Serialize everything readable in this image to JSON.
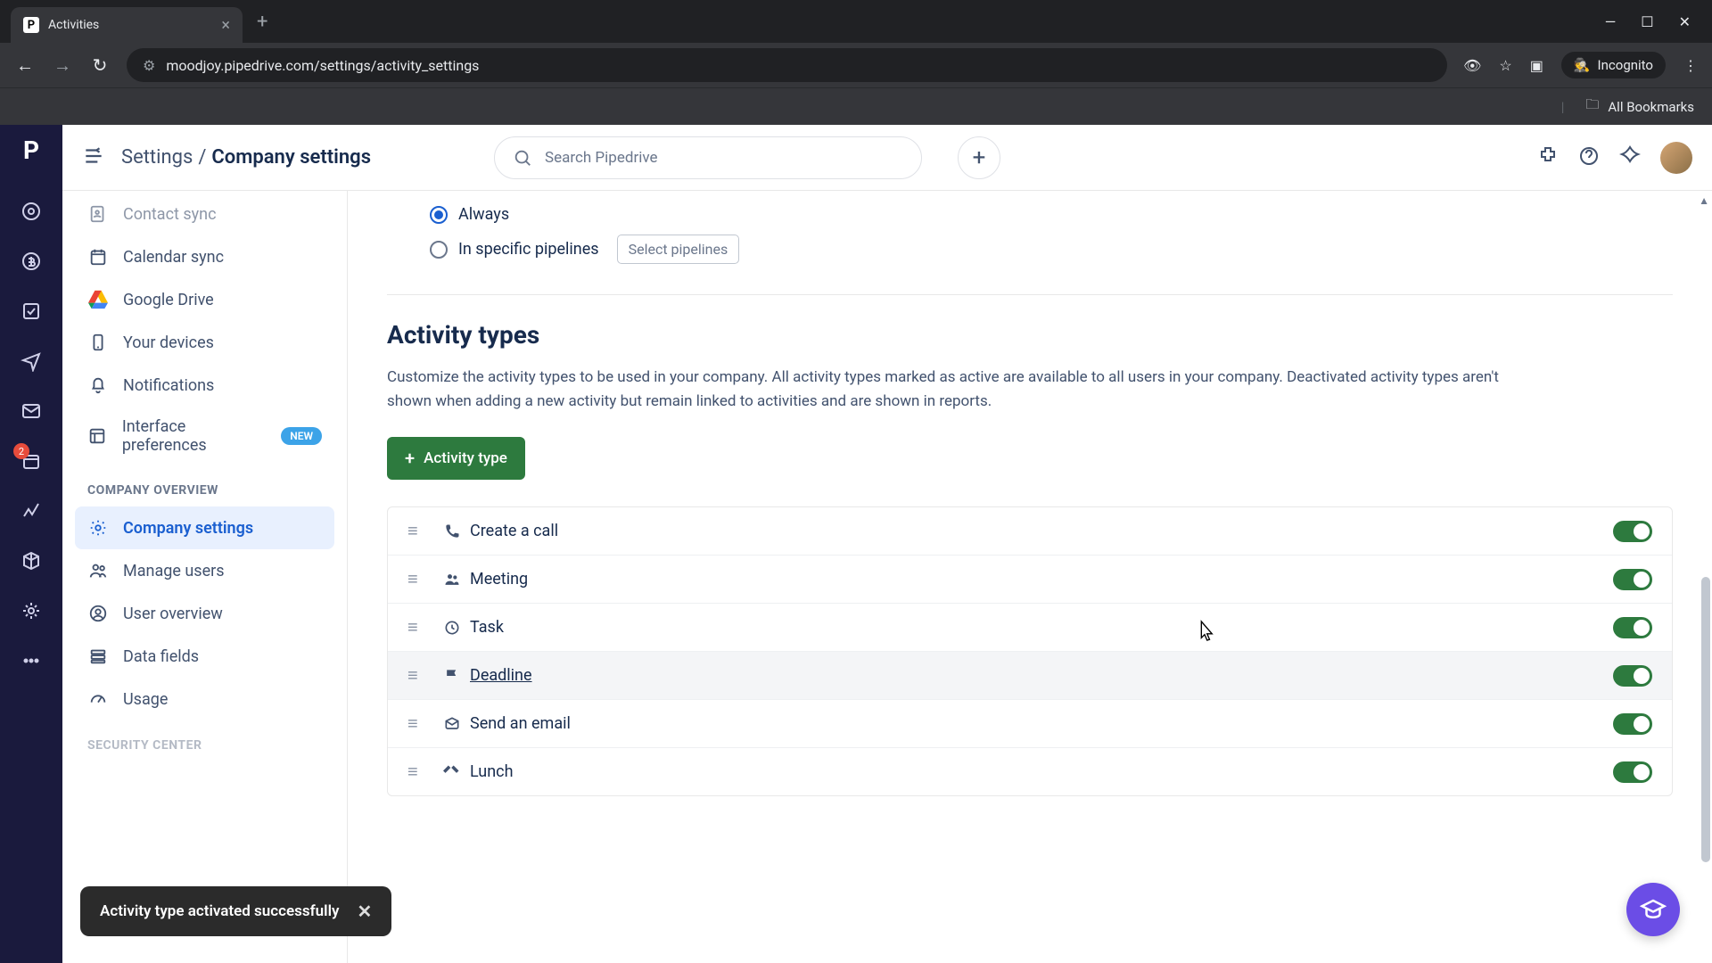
{
  "browser": {
    "tab_title": "Activities",
    "url": "moodjoy.pipedrive.com/settings/activity_settings",
    "incognito_label": "Incognito",
    "all_bookmarks": "All Bookmarks"
  },
  "header": {
    "breadcrumb_root": "Settings",
    "breadcrumb_current": "Company settings",
    "search_placeholder": "Search Pipedrive"
  },
  "rail": {
    "badge_count": "2"
  },
  "sidebar": {
    "items": [
      {
        "label": "Contact sync",
        "icon": "contact"
      },
      {
        "label": "Calendar sync",
        "icon": "calendar"
      },
      {
        "label": "Google Drive",
        "icon": "gdrive"
      },
      {
        "label": "Your devices",
        "icon": "phone"
      },
      {
        "label": "Notifications",
        "icon": "bell"
      },
      {
        "label": "Interface preferences",
        "icon": "layout",
        "badge": "NEW"
      }
    ],
    "heading": "COMPANY OVERVIEW",
    "company_items": [
      {
        "label": "Company settings",
        "icon": "gear",
        "active": true
      },
      {
        "label": "Manage users",
        "icon": "users"
      },
      {
        "label": "User overview",
        "icon": "usercircle"
      },
      {
        "label": "Data fields",
        "icon": "fields"
      },
      {
        "label": "Usage",
        "icon": "gauge"
      }
    ],
    "heading2": "SECURITY CENTER"
  },
  "main": {
    "radio_always": "Always",
    "radio_pipelines": "In specific pipelines",
    "select_pipelines_label": "Select pipelines",
    "section_title": "Activity types",
    "section_desc": "Customize the activity types to be used in your company. All activity types marked as active are available to all users in your company. Deactivated activity types aren't shown when adding a new activity but remain linked to activities and are shown in reports.",
    "add_button": "Activity type",
    "types": [
      {
        "label": "Create a call",
        "icon": "call"
      },
      {
        "label": "Meeting",
        "icon": "people"
      },
      {
        "label": "Task",
        "icon": "clock"
      },
      {
        "label": "Deadline",
        "icon": "flag",
        "hover": true
      },
      {
        "label": "Send an email",
        "icon": "mail"
      },
      {
        "label": "Lunch",
        "icon": "food"
      }
    ]
  },
  "toast": {
    "message": "Activity type activated successfully"
  }
}
